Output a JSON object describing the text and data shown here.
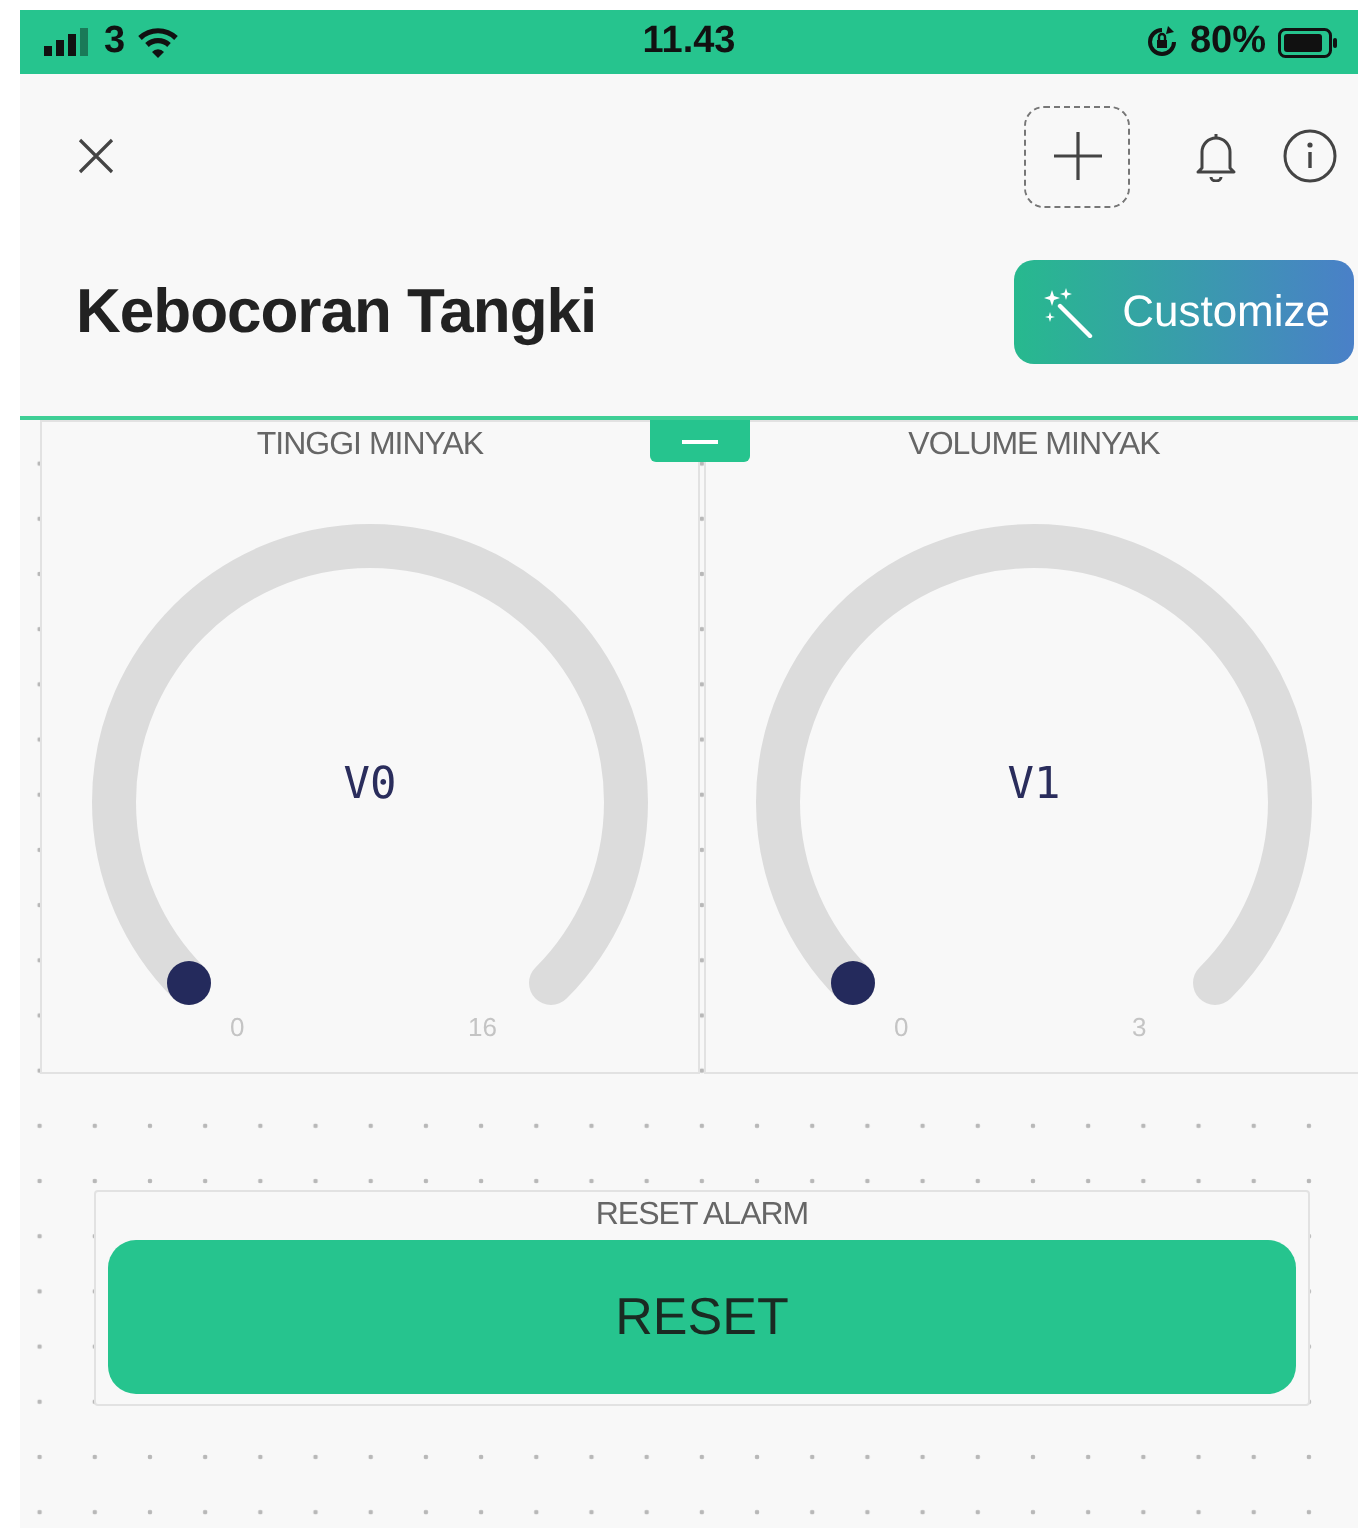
{
  "status_bar": {
    "carrier": "3",
    "time": "11.43",
    "battery": "80%"
  },
  "header": {
    "title": "Kebocoran Tangki",
    "customize_button": "Customize"
  },
  "gauges": [
    {
      "label": "TINGGI MINYAK",
      "value": "V0",
      "min": "0",
      "max": "16"
    },
    {
      "label": "VOLUME MINYAK",
      "value": "V1",
      "min": "0",
      "max": "3"
    }
  ],
  "reset_widget": {
    "label": "RESET ALARM",
    "button": "RESET"
  }
}
